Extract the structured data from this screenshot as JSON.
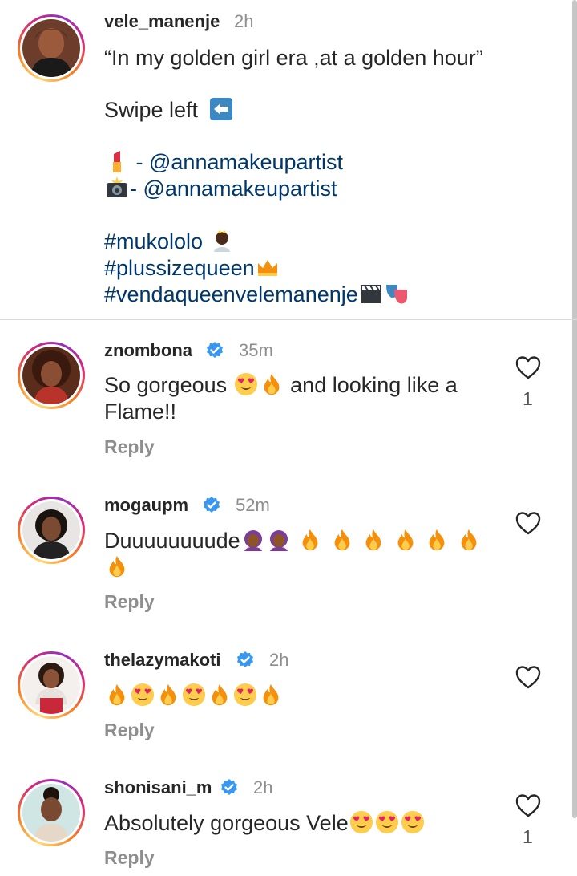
{
  "caption": {
    "username": "vele_manenje",
    "time": "2h",
    "lines": [
      "“In my golden girl era ,at a golden hour”",
      "Swipe left",
      "- @annamakeupartist",
      "- @annamakeupartist",
      "#mukololo",
      "#plussizequeen",
      "#vendaqueenvelemanenje"
    ]
  },
  "comments": [
    {
      "username": "znombona",
      "verified": true,
      "time": "35m",
      "text_1": "So gorgeous",
      "text_2": "and looking like a",
      "text_3": "Flame!!",
      "reply": "Reply",
      "likes": "1"
    },
    {
      "username": "mogaupm",
      "verified": true,
      "time": "52m",
      "text_1": "Duuuuuuuude",
      "reply": "Reply",
      "likes": ""
    },
    {
      "username": "thelazymakoti",
      "verified": true,
      "time": "2h",
      "reply": "Reply",
      "likes": ""
    },
    {
      "username": "shonisani_m",
      "verified": true,
      "time": "2h",
      "text_1": "Absolutely gorgeous Vele",
      "reply": "Reply",
      "likes": "1"
    }
  ],
  "colors": {
    "text": "#262626",
    "muted": "#8e8e8e",
    "link": "#00376b",
    "verified": "#3897f0"
  },
  "icons": [
    "heart-outline-icon",
    "verified-badge-icon",
    "fire-emoji",
    "heart-eyes-emoji",
    "lipstick-emoji",
    "camera-flash-emoji",
    "left-arrow-emoji",
    "crown-emoji",
    "princess-emoji",
    "clapper-emoji",
    "theater-masks-emoji",
    "facepalm-emoji"
  ]
}
